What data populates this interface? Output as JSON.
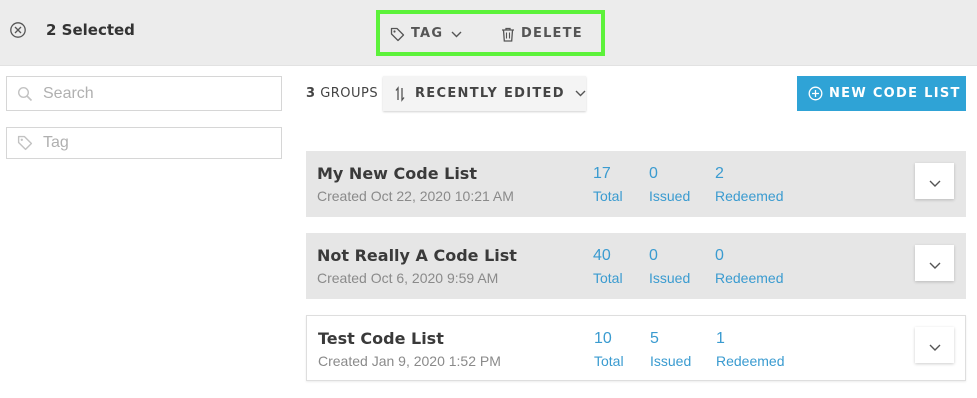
{
  "selection": {
    "count_label": "2 Selected"
  },
  "actions": {
    "tag_label": "TAG",
    "delete_label": "DELETE"
  },
  "filters": {
    "search_placeholder": "Search",
    "tag_placeholder": "Tag"
  },
  "toolbar": {
    "groups_count": "3",
    "groups_label": "GROUPS",
    "sort_label": "RECENTLY EDITED",
    "new_label": "NEW CODE LIST"
  },
  "colors": {
    "accent": "#2fa3d6",
    "highlight": "#5cf23a",
    "stat_text": "#3a9bd0"
  },
  "code_lists": [
    {
      "name": "My New Code List",
      "created": "Created Oct 22, 2020 10:21 AM",
      "total": "17",
      "total_label": "Total",
      "issued": "0",
      "issued_label": "Issued",
      "redeemed": "2",
      "redeemed_label": "Redeemed"
    },
    {
      "name": "Not Really A Code List",
      "created": "Created Oct 6, 2020 9:59 AM",
      "total": "40",
      "total_label": "Total",
      "issued": "0",
      "issued_label": "Issued",
      "redeemed": "0",
      "redeemed_label": "Redeemed"
    },
    {
      "name": "Test Code List",
      "created": "Created Jan 9, 2020 1:52 PM",
      "total": "10",
      "total_label": "Total",
      "issued": "5",
      "issued_label": "Issued",
      "redeemed": "1",
      "redeemed_label": "Redeemed"
    }
  ]
}
